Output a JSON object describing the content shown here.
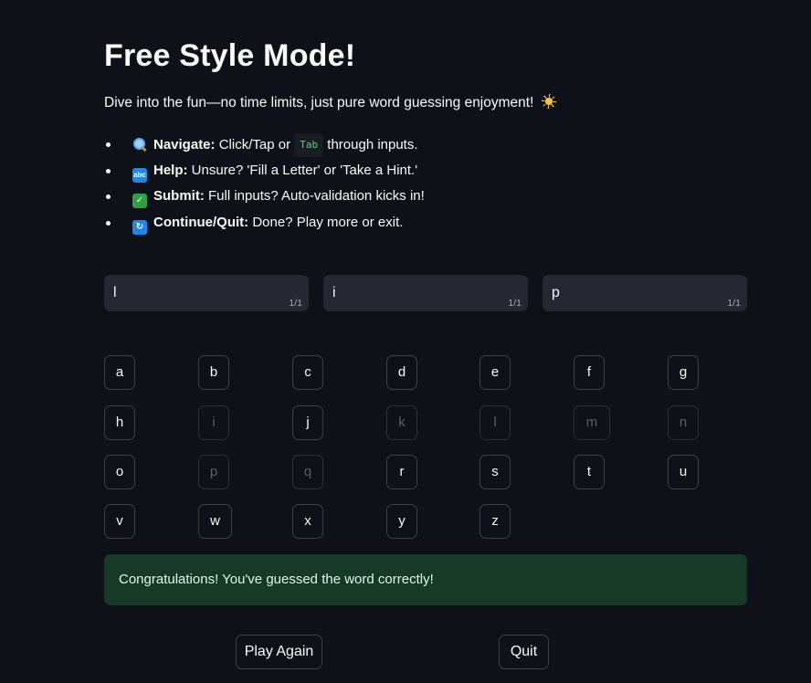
{
  "title": "Free Style Mode!",
  "intro": "Dive into the fun—no time limits, just pure word guessing enjoyment!",
  "tips": [
    {
      "icon": "magnifier-icon",
      "label": "Navigate:",
      "text_before": "Click/Tap or",
      "kbd": "Tab",
      "text_after": "through inputs."
    },
    {
      "icon": "abc-icon",
      "label": "Help:",
      "text": "Unsure? 'Fill a Letter' or 'Take a Hint.'"
    },
    {
      "icon": "check-icon",
      "label": "Submit:",
      "text": "Full inputs? Auto-validation kicks in!"
    },
    {
      "icon": "cycle-icon",
      "label": "Continue/Quit:",
      "text": "Done? Play more or exit."
    }
  ],
  "inputs": [
    {
      "value": "l",
      "counter": "1/1"
    },
    {
      "value": "i",
      "counter": "1/1"
    },
    {
      "value": "p",
      "counter": "1/1"
    }
  ],
  "letters": [
    {
      "letter": "a",
      "disabled": false
    },
    {
      "letter": "b",
      "disabled": false
    },
    {
      "letter": "c",
      "disabled": false
    },
    {
      "letter": "d",
      "disabled": false
    },
    {
      "letter": "e",
      "disabled": false
    },
    {
      "letter": "f",
      "disabled": false
    },
    {
      "letter": "g",
      "disabled": false
    },
    {
      "letter": "h",
      "disabled": false
    },
    {
      "letter": "i",
      "disabled": true
    },
    {
      "letter": "j",
      "disabled": false
    },
    {
      "letter": "k",
      "disabled": true
    },
    {
      "letter": "l",
      "disabled": true
    },
    {
      "letter": "m",
      "disabled": true
    },
    {
      "letter": "n",
      "disabled": true
    },
    {
      "letter": "o",
      "disabled": false
    },
    {
      "letter": "p",
      "disabled": true
    },
    {
      "letter": "q",
      "disabled": true
    },
    {
      "letter": "r",
      "disabled": false
    },
    {
      "letter": "s",
      "disabled": false
    },
    {
      "letter": "t",
      "disabled": false
    },
    {
      "letter": "u",
      "disabled": false
    },
    {
      "letter": "v",
      "disabled": false
    },
    {
      "letter": "w",
      "disabled": false
    },
    {
      "letter": "x",
      "disabled": false
    },
    {
      "letter": "y",
      "disabled": false
    },
    {
      "letter": "z",
      "disabled": false
    }
  ],
  "success_message": "Congratulations! You've guessed the word correctly!",
  "actions": {
    "play_again": "Play Again",
    "quit": "Quit"
  },
  "colors": {
    "background": "#0e1117",
    "input_bg": "#262730",
    "success_bg": "#173928",
    "kbd_text": "#5ece8a"
  }
}
